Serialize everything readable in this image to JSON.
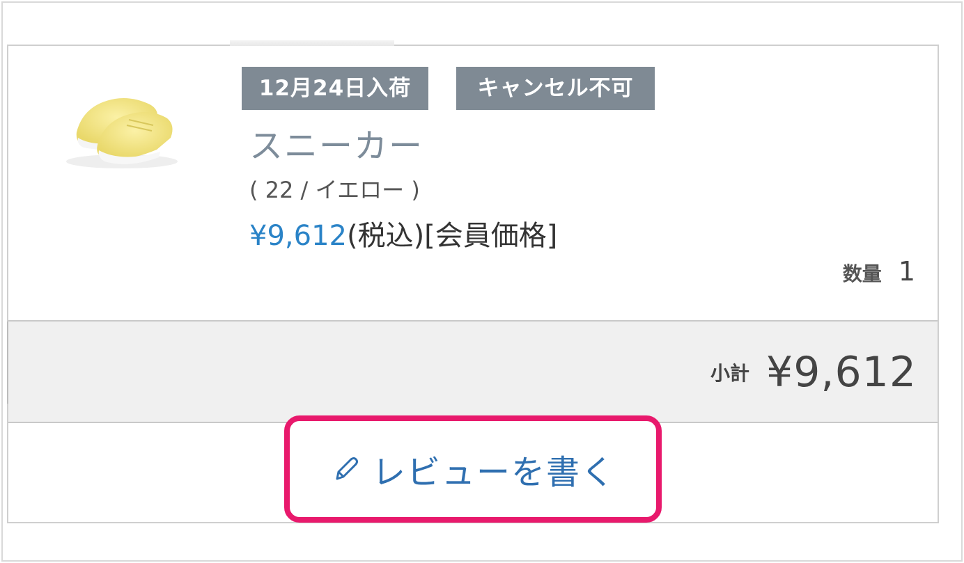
{
  "item": {
    "badges": {
      "arrival": "12月24日入荷",
      "cancel": "キャンセル不可"
    },
    "product_name": "スニーカー",
    "variant": "( 22 / イエロー )",
    "price": "¥9,612",
    "price_suffix": "(税込)[会員価格]",
    "quantity_label": "数量",
    "quantity": "1",
    "image_icon": "yellow-sneakers-image"
  },
  "subtotal": {
    "label": "小計",
    "value": "¥9,612"
  },
  "review": {
    "icon": "pencil-icon",
    "label": "レビューを書く"
  },
  "colors": {
    "accent_price": "#2a83c7",
    "badge_bg": "#7f8a94",
    "highlight_border": "#e8196c",
    "review_text": "#2f6fb0"
  }
}
